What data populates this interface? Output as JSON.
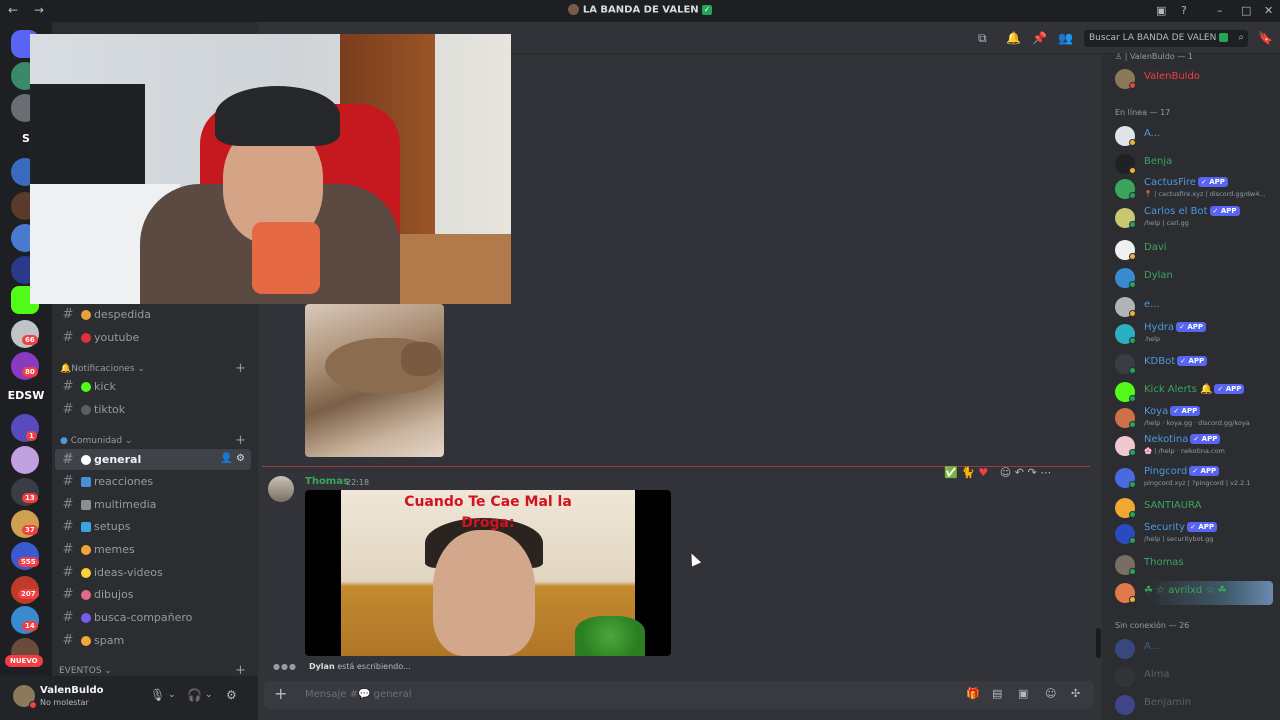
{
  "window": {
    "title": "LA BANDA DE VALEN",
    "nav_back": "←",
    "nav_fwd": "→"
  },
  "servers": {
    "badges": [
      "66",
      "80",
      "1",
      "13",
      "37",
      "555",
      "207",
      "14"
    ],
    "text_items": [
      "S",
      "EDSW"
    ],
    "new_label": "NUEVO"
  },
  "sidebar": {
    "channels_top": [
      {
        "name": "despedida",
        "color": "#e8a23a"
      },
      {
        "name": "youtube",
        "color": "#e0313a"
      }
    ],
    "cat_notifications": "Notificaciones",
    "channels_notif": [
      {
        "name": "kick",
        "color": "#53fc18"
      },
      {
        "name": "tiktok",
        "color": "#5a5d63"
      }
    ],
    "cat_community": "Comunidad",
    "channels_community": [
      {
        "name": "general",
        "color": "#ffffff"
      },
      {
        "name": "reacciones",
        "color": "#4a8fd8"
      },
      {
        "name": "multimedia",
        "color": "#8a8d92"
      },
      {
        "name": "setups",
        "color": "#3aa2e0"
      },
      {
        "name": "memes",
        "color": "#f3a33a"
      },
      {
        "name": "ideas-videos",
        "color": "#f7d23a"
      },
      {
        "name": "dibujos",
        "color": "#e06a8a"
      },
      {
        "name": "busca-compañero",
        "color": "#7a5af0"
      },
      {
        "name": "spam",
        "color": "#f0a83a"
      }
    ],
    "cat_events": "EVENTOS"
  },
  "user": {
    "name": "ValenBuldo",
    "status": "No molestar"
  },
  "header": {
    "search_placeholder": "Buscar LA BANDA DE VALEN"
  },
  "message": {
    "author": "Thomas",
    "time": "22:18",
    "video_caption_line1": "Cuando Te Cae Mal la",
    "video_caption_line2": "Droga:"
  },
  "typing": {
    "user": "Dylan",
    "text": "está escribiendo..."
  },
  "composer": {
    "placeholder": "Mensaje #💬 general"
  },
  "members": {
    "owner_group": "| ValenBuldo — 1",
    "owner": {
      "name": "ValenBuldo",
      "color": "#f23f43"
    },
    "online_group": "En línea — 17",
    "online": [
      {
        "name": "A...",
        "color": "#4a9ae0",
        "sub": "",
        "app": false
      },
      {
        "name": "Benja",
        "color": "#3ba55d",
        "sub": "",
        "app": false
      },
      {
        "name": "CactusFire",
        "color": "#4a9ae0",
        "sub": "📍 | cactusfire.xyz | discord.gg/dw4...",
        "app": true
      },
      {
        "name": "Carlos el Bot",
        "color": "#4a9ae0",
        "sub": "/help | carl.gg",
        "app": true
      },
      {
        "name": "Davi",
        "color": "#3ba55d",
        "sub": "",
        "app": false
      },
      {
        "name": "Dylan",
        "color": "#3ba55d",
        "sub": "",
        "app": false
      },
      {
        "name": "e...",
        "color": "#4a9ae0",
        "sub": "",
        "app": false
      },
      {
        "name": "Hydra",
        "color": "#4a9ae0",
        "sub": ".help",
        "app": true
      },
      {
        "name": "KDBot",
        "color": "#4a9ae0",
        "sub": "",
        "app": true
      },
      {
        "name": "Kick Alerts 🔔",
        "color": "#3ba55d",
        "sub": "",
        "app": true
      },
      {
        "name": "Koya",
        "color": "#4a9ae0",
        "sub": "/help · koya.gg · discord.gg/koya",
        "app": true
      },
      {
        "name": "Nekotina",
        "color": "#4a9ae0",
        "sub": "🌸 | /help · nekotina.com",
        "app": true
      },
      {
        "name": "Pingcord",
        "color": "#4a9ae0",
        "sub": "pingcord.xyz | ?pingcord | v2.2.1",
        "app": true
      },
      {
        "name": "SANTIAURA",
        "color": "#3ba55d",
        "sub": "",
        "app": false
      },
      {
        "name": "Security",
        "color": "#4a9ae0",
        "sub": "/help | securitybot.gg",
        "app": true
      },
      {
        "name": "Thomas",
        "color": "#3ba55d",
        "sub": "",
        "app": false
      },
      {
        "name": "☘ ☆ avrilxd ☆ ☘",
        "color": "#3ba55d",
        "sub": "",
        "app": false
      }
    ],
    "offline_group": "Sin conexión — 26",
    "offline": [
      {
        "name": "A...",
        "color": "#4a9ae0"
      },
      {
        "name": "Alma",
        "color": "#949ba4"
      },
      {
        "name": "Benjamin",
        "color": "#949ba4"
      }
    ],
    "app_label": "✓ APP"
  },
  "colors": {
    "accent": "#5865f2",
    "online": "#23a55a",
    "dnd": "#f23f43"
  }
}
